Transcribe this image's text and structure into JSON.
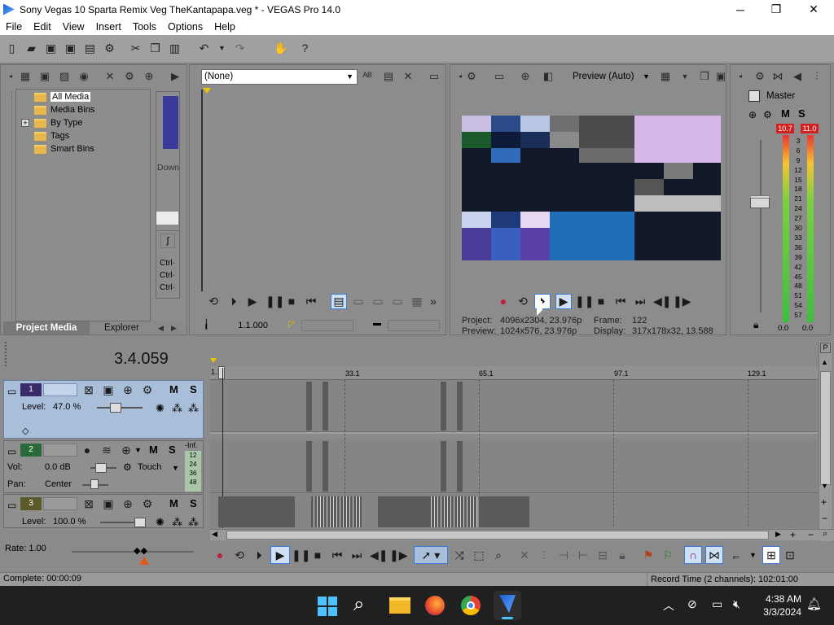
{
  "window": {
    "title": "Sony Vegas 10 Sparta Remix Veg TheKantapapa.veg * - VEGAS Pro 14.0",
    "minimize": "─",
    "maximize": "❐",
    "close": "✕"
  },
  "menu": [
    "File",
    "Edit",
    "View",
    "Insert",
    "Tools",
    "Options",
    "Help"
  ],
  "media_panel": {
    "tree": [
      "All Media",
      "Media Bins",
      "By Type",
      "Tags",
      "Smart Bins"
    ],
    "expander": "+",
    "tabs": [
      "Project Media",
      "Explorer"
    ],
    "preview_caption": "Down",
    "ctrl_labels": [
      "Ctrl·",
      "Ctrl·",
      "Ctrl·"
    ]
  },
  "trimmer": {
    "dropdown_value": "(None)",
    "timecode": "1.1.000"
  },
  "preview": {
    "quality": "Preview (Auto)",
    "project_label": "Project:",
    "project_value": "4096x2304, 23.976p",
    "preview_label": "Preview:",
    "preview_value": "1024x576, 23.976p",
    "frame_label": "Frame:",
    "frame_value": "122",
    "display_label": "Display:",
    "display_value": "317x178x32, 13.588"
  },
  "master": {
    "label": "Master",
    "m": "M",
    "s": "S",
    "peak_left": "10.7",
    "peak_right": "11.0",
    "scale": [
      "3",
      "6",
      "9",
      "12",
      "15",
      "18",
      "21",
      "24",
      "27",
      "30",
      "33",
      "36",
      "39",
      "42",
      "45",
      "48",
      "51",
      "54",
      "57"
    ],
    "level_left": "0.0",
    "level_right": "0.0"
  },
  "timeline": {
    "position": "3.4.059",
    "ruler_marks": [
      "1.1",
      "33.1",
      "65.1",
      "97.1",
      "129.1"
    ],
    "tracks": [
      {
        "num": "1",
        "level_label": "Level:",
        "level_value": "47.0 %",
        "m": "M",
        "s": "S"
      },
      {
        "num": "2",
        "vol_label": "Vol:",
        "vol_value": "0.0 dB",
        "pan_label": "Pan:",
        "pan_value": "Center",
        "mode": "Touch",
        "m": "M",
        "s": "S",
        "inf": "-Inf.",
        "meter": [
          "12",
          "24",
          "36",
          "48"
        ]
      },
      {
        "num": "3",
        "level_label": "Level:",
        "level_value": "100.0 %",
        "m": "M",
        "s": "S"
      }
    ],
    "rate": "Rate: 1.00"
  },
  "status": {
    "left": "Complete: 00:00:09",
    "right": "Record Time (2 channels): 102:01:00"
  },
  "taskbar": {
    "time": "4:38 AM",
    "date": "3/3/2024"
  },
  "colors": {
    "accent_blue": "#3a78d8",
    "track_selected": "#a9bed8",
    "meter_peak": "#d42020"
  }
}
